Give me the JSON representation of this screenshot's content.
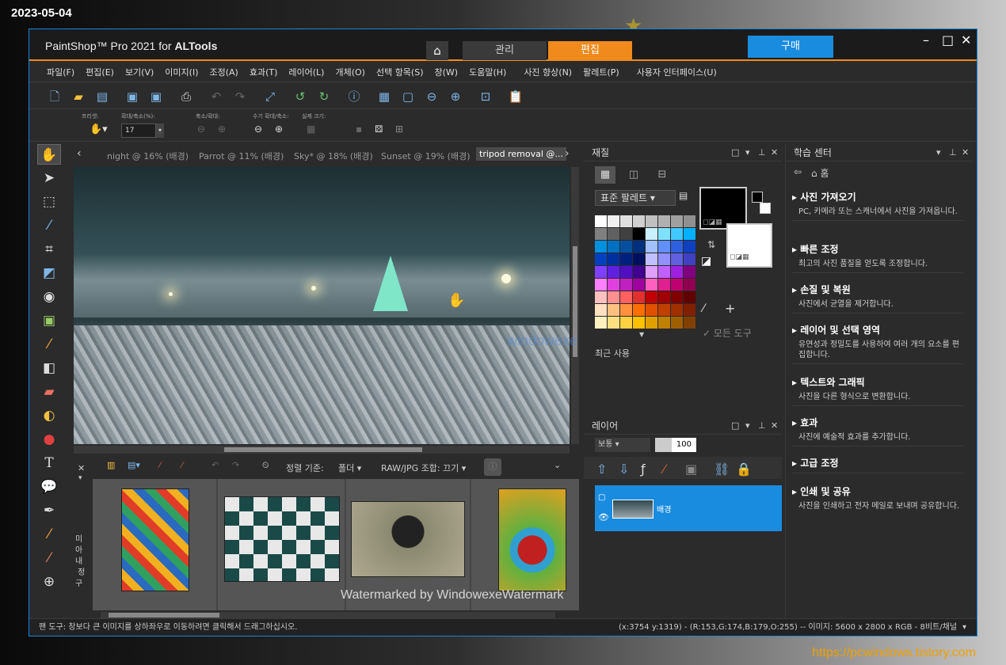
{
  "date_stamp": "2023-05-04",
  "url_stamp": "https://pcwindows.tistory.com",
  "app": {
    "title_prefix": "PaintShop™ Pro 2021 for ",
    "title_brand": "ALTools",
    "tab_manage": "관리",
    "tab_edit": "편집",
    "buy": "구매"
  },
  "menu": [
    "파일(F)",
    "편집(E)",
    "보기(V)",
    "이미지(I)",
    "조정(A)",
    "효과(T)",
    "레이어(L)",
    "개체(O)",
    "선택 항목(S)",
    "창(W)",
    "도움말(H)",
    "사진 향상(N)",
    "팔레트(P)",
    "사용자 인터페이스(U)"
  ],
  "options": {
    "preset": "프리셋:",
    "zoom_label": "확대/축소(%):",
    "zoom_value": "17",
    "zoom_inout": "축소/확대:",
    "zoom_more": "수기 확대/축소:",
    "actual": "실제 크기:"
  },
  "doc_tabs": [
    "night @  16% (배경)",
    "Parrot @  11% (배경)",
    "Sky* @  18% (배경)",
    "Sunset @  19% (배경)",
    "tripod removal @..."
  ],
  "organizer": {
    "sort_label": "정렬 기준:",
    "sort_value": "폴더",
    "raw_label": "RAW/JPG 조합: 끄기",
    "side_label": "미\n아\n내\n 정\n구"
  },
  "materials": {
    "title": "재질",
    "palette_select": "표준 팔레트",
    "all_tools": "모든 도구",
    "recent": "최근 사용",
    "swatches": [
      "#ffffff",
      "#f0f0f0",
      "#e0e0e0",
      "#d0d0d0",
      "#c0c0c0",
      "#b0b0b0",
      "#a0a0a0",
      "#909090",
      "#808080",
      "#606060",
      "#404040",
      "#000000",
      "#c8f0ff",
      "#80e0ff",
      "#40c8ff",
      "#00b0ff",
      "#0090e0",
      "#0070c0",
      "#0050a0",
      "#003080",
      "#a0c0ff",
      "#6090ff",
      "#3060e0",
      "#1040c0",
      "#0040c0",
      "#0030a0",
      "#002080",
      "#001060",
      "#c0c0ff",
      "#9090ff",
      "#6060e0",
      "#4040c0",
      "#8040ff",
      "#6020e0",
      "#5010c0",
      "#400090",
      "#e0a0ff",
      "#c060ff",
      "#a020e0",
      "#800080",
      "#ff80ff",
      "#e040e0",
      "#c020c0",
      "#a000a0",
      "#ff60c0",
      "#e02090",
      "#c00070",
      "#900050",
      "#ffc0c0",
      "#ff9090",
      "#ff6060",
      "#e03030",
      "#c00000",
      "#a00000",
      "#800000",
      "#600000",
      "#ffe0c0",
      "#ffc080",
      "#ff9040",
      "#ff7000",
      "#e05000",
      "#c04000",
      "#a03000",
      "#802000",
      "#fff0c0",
      "#ffe080",
      "#ffd040",
      "#ffc000",
      "#e0a000",
      "#c08000",
      "#a06000",
      "#804000"
    ]
  },
  "layers": {
    "title": "레이어",
    "blend": "보통",
    "opacity": "100",
    "layer_name": "배경"
  },
  "learning": {
    "title": "학습 센터",
    "home": "홈",
    "items": [
      {
        "title": "사진 가져오기",
        "desc": "PC, 카메라 또는 스캐너에서 사진을 가져옵니다."
      },
      {
        "title": "빠른 조정",
        "desc": "최고의 사진 품질을 얻도록 조정합니다."
      },
      {
        "title": "손질 및 복원",
        "desc": "사진에서 균열을 제거합니다."
      },
      {
        "title": "레이어 및 선택 영역",
        "desc": "유연성과 정밀도를 사용하여 여러 개의 요소를 편집합니다."
      },
      {
        "title": "텍스트와 그래픽",
        "desc": "사진을 다른 형식으로 변환합니다."
      },
      {
        "title": "효과",
        "desc": "사진에 예술적 효과를 추가합니다."
      },
      {
        "title": "고급 조정",
        "desc": ""
      },
      {
        "title": "인쇄 및 공유",
        "desc": "사진을 인쇄하고 전자 메일로 보내며 공유합니다."
      }
    ]
  },
  "status": {
    "left": "팬 도구: 창보다 큰 이미지를 상하좌우로 이동하려면 클릭해서 드래그하십시오.",
    "coords": "(x:3754 y:1319) - (R:153,G:174,B:179,O:255) -- 이미지:  5600 x 2800 x RGB - 8비트/채널"
  },
  "watermark": "Watermarked by WindowexeWatermark",
  "watermark2": "windowexe"
}
